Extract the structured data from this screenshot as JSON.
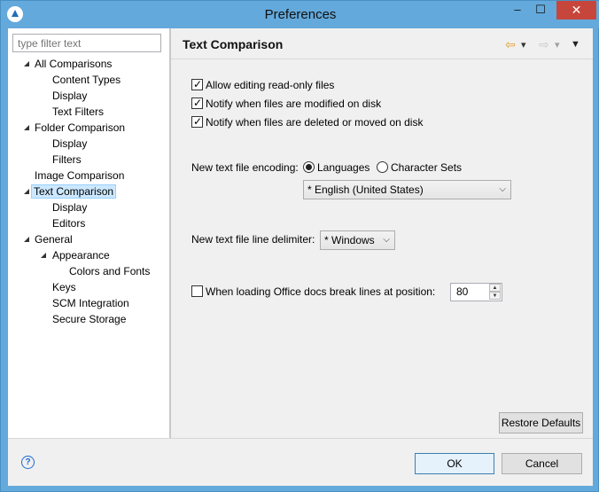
{
  "window": {
    "title": "Preferences",
    "minimize": "‒",
    "maximize": "☐",
    "close": "✕"
  },
  "sidebar": {
    "filter_placeholder": "type filter text",
    "items": [
      {
        "label": "All Comparisons"
      },
      {
        "label": "Content Types"
      },
      {
        "label": "Display"
      },
      {
        "label": "Text Filters"
      },
      {
        "label": "Folder Comparison"
      },
      {
        "label": "Display"
      },
      {
        "label": "Filters"
      },
      {
        "label": "Image Comparison"
      },
      {
        "label": "Text Comparison"
      },
      {
        "label": "Display"
      },
      {
        "label": "Editors"
      },
      {
        "label": "General"
      },
      {
        "label": "Appearance"
      },
      {
        "label": "Colors and Fonts"
      },
      {
        "label": "Keys"
      },
      {
        "label": "SCM Integration"
      },
      {
        "label": "Secure Storage"
      }
    ]
  },
  "page": {
    "title": "Text Comparison",
    "back_icon": "⇦",
    "forward_icon": "⇨",
    "dropdown_icon": "▾",
    "menu_icon": "▼",
    "checkbox1": "Allow editing read-only files",
    "checkbox2": "Notify when files are modified on disk",
    "checkbox3": "Notify when files are deleted or moved on disk",
    "encoding_label": "New text file encoding:",
    "radio_languages": "Languages",
    "radio_charsets": "Character Sets",
    "encoding_value": "* English (United States)",
    "delimiter_label": "New text file line delimiter:",
    "delimiter_value": "* Windows",
    "office_label": "When loading Office docs break lines at position:",
    "office_value": "80",
    "restore_defaults": "Restore Defaults"
  },
  "footer": {
    "help": "?",
    "ok": "OK",
    "cancel": "Cancel"
  }
}
